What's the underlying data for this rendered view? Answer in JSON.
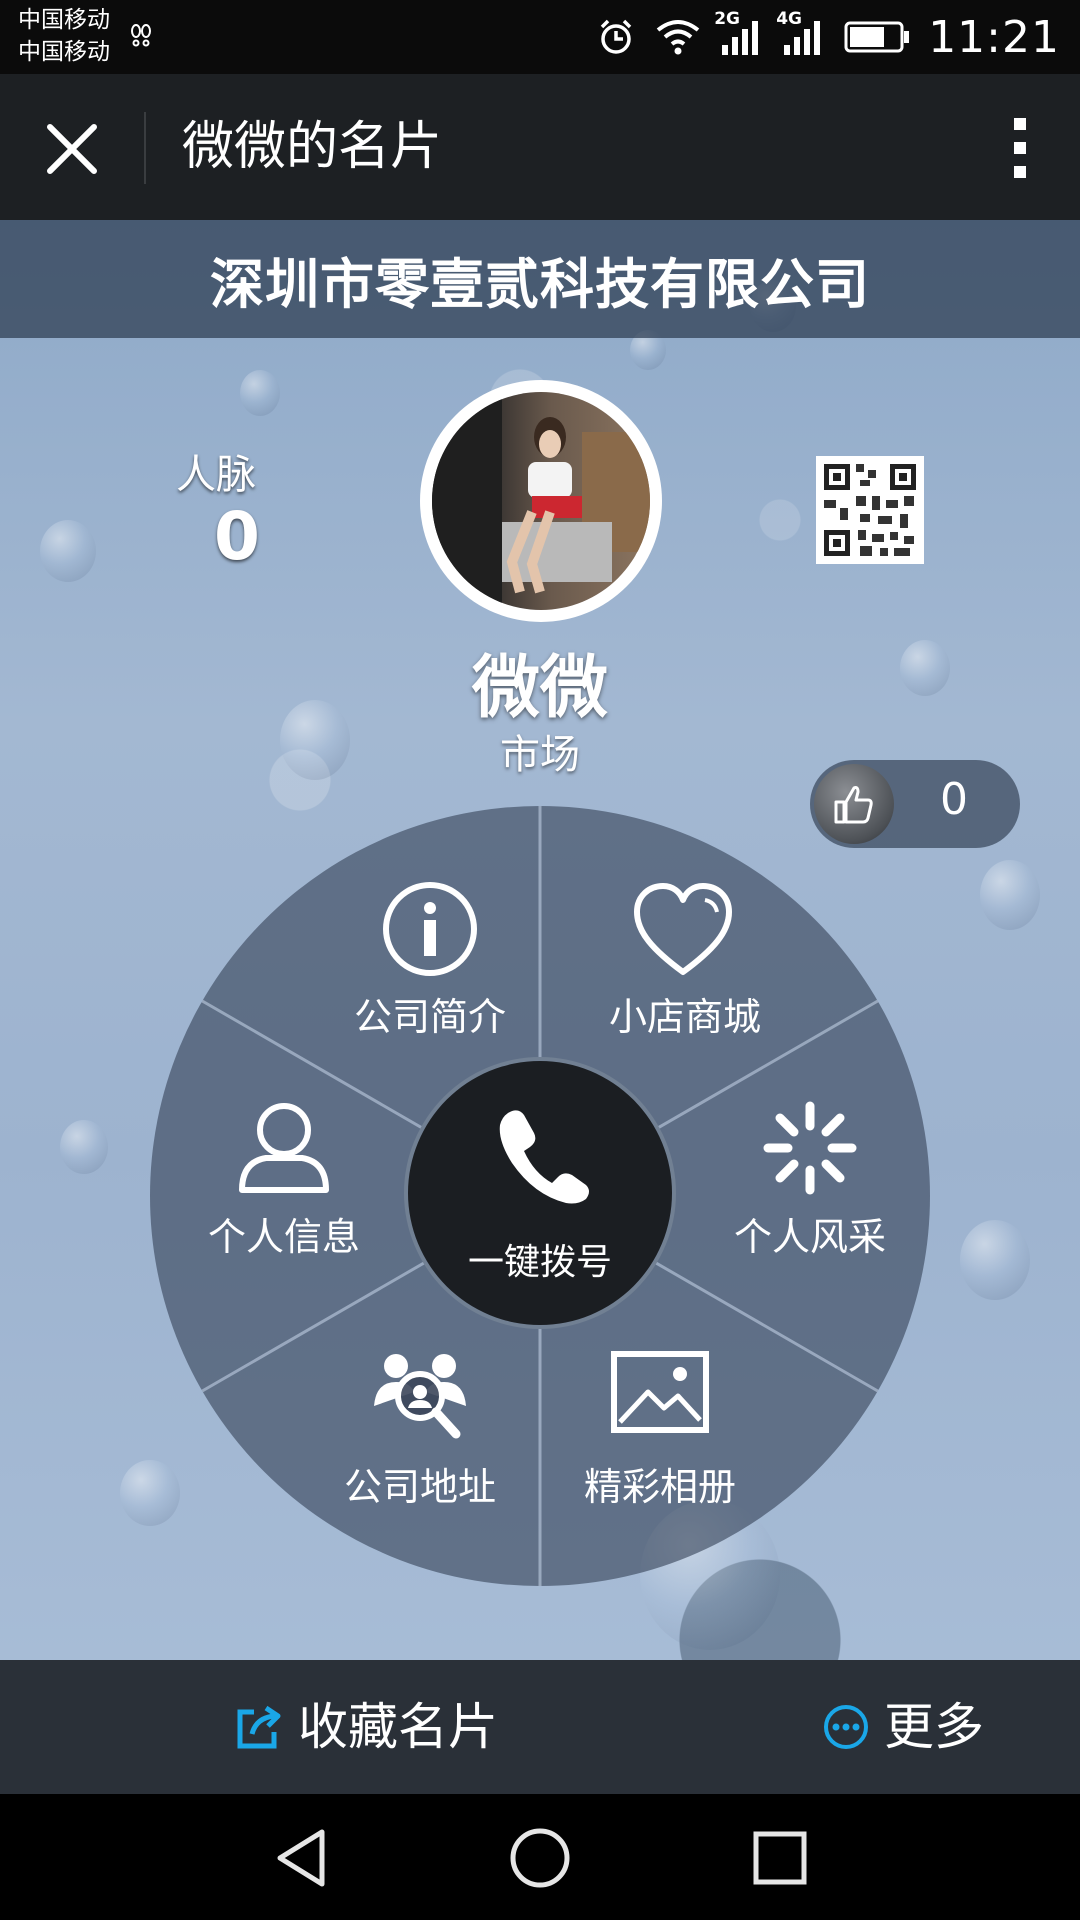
{
  "status_bar": {
    "carrier_1": "中国移动",
    "carrier_2": "中国移动",
    "network_1": "2G",
    "network_2": "4G",
    "time": "11:21"
  },
  "title_bar": {
    "title": "微微的名片",
    "close_icon": "close-icon",
    "menu_icon": "more-vertical-icon"
  },
  "card": {
    "company": "深圳市零壹贰科技有限公司",
    "contacts_label": "人脉",
    "contacts_count": "0",
    "name": "微微",
    "department": "市场",
    "likes": "0"
  },
  "wheel": {
    "center_label": "一键拨号",
    "items": [
      {
        "label": "公司简介",
        "icon": "info-icon"
      },
      {
        "label": "小店商城",
        "icon": "heart-icon"
      },
      {
        "label": "个人风采",
        "icon": "loading-burst-icon"
      },
      {
        "label": "精彩相册",
        "icon": "image-icon"
      },
      {
        "label": "公司地址",
        "icon": "people-search-icon"
      },
      {
        "label": "个人信息",
        "icon": "person-icon"
      }
    ]
  },
  "actions": {
    "save_label": "收藏名片",
    "more_label": "更多"
  },
  "colors": {
    "accent_blue": "#1aa7e8",
    "titlebar": "#1d2023",
    "actionbar": "#2a3038"
  }
}
